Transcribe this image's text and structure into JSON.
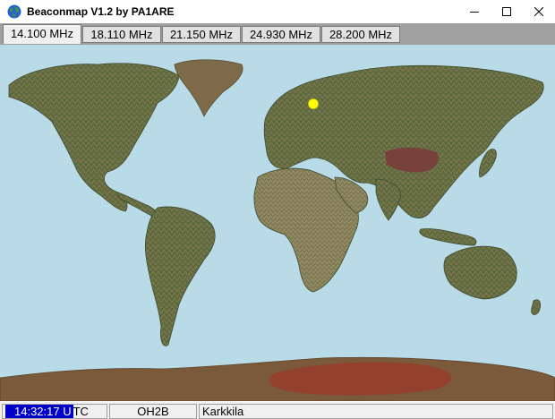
{
  "window": {
    "title": "Beaconmap V1.2 by PA1ARE"
  },
  "controls": {
    "minimize": "minimize-icon",
    "maximize": "maximize-icon",
    "close": "close-icon"
  },
  "tabs": [
    {
      "label": "14.100 MHz",
      "active": true
    },
    {
      "label": "18.110 MHz",
      "active": false
    },
    {
      "label": "21.150 MHz",
      "active": false
    },
    {
      "label": "24.930 MHz",
      "active": false
    },
    {
      "label": "28.200 MHz",
      "active": false
    }
  ],
  "map": {
    "ocean_color": "#b9dbe7",
    "beacon_color": "#ffff00"
  },
  "status": {
    "time": "14:32:17 U",
    "time_suffix": "TC",
    "callsign": "OH2B",
    "location": "Karkkila"
  }
}
